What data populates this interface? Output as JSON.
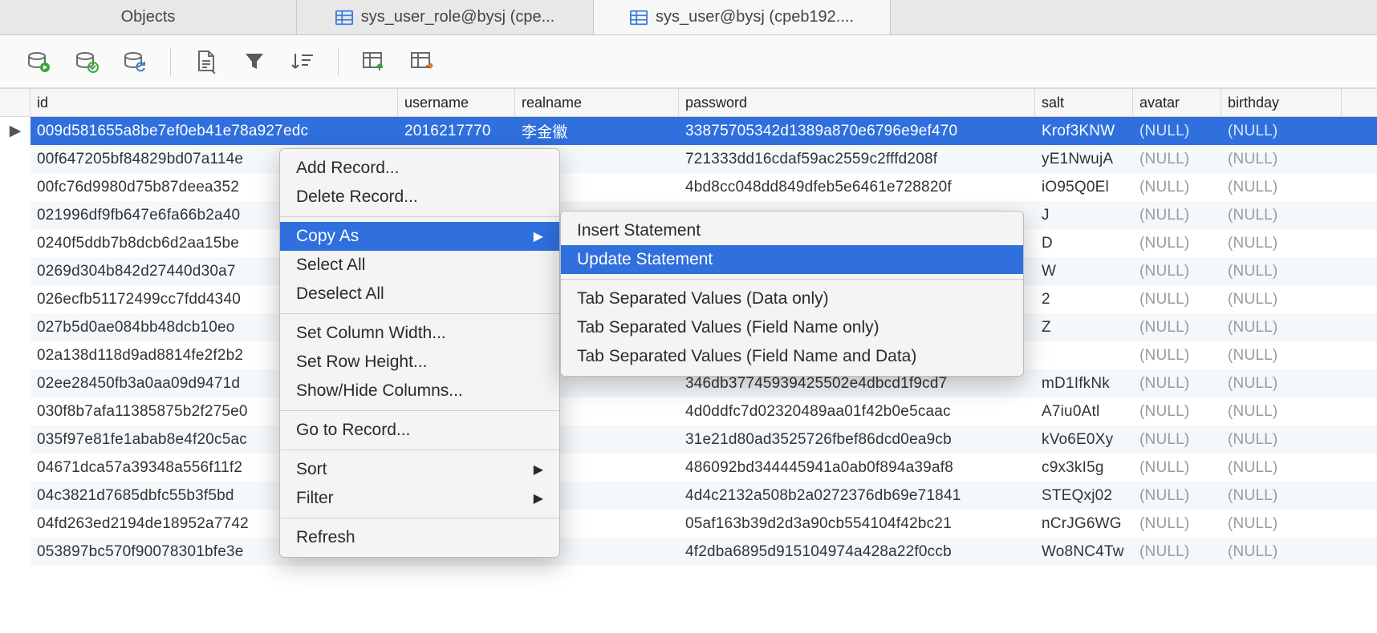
{
  "tabs": {
    "objects": "Objects",
    "t1": "sys_user_role@bysj (cpe...",
    "t2": "sys_user@bysj (cpeb192....",
    "active": "t2"
  },
  "columns": {
    "id": "id",
    "username": "username",
    "realname": "realname",
    "password": "password",
    "salt": "salt",
    "avatar": "avatar",
    "birthday": "birthday"
  },
  "null_text": "(NULL)",
  "rows": [
    {
      "id": "009d581655a8be7ef0eb41e78a927edc",
      "username": "2016217770",
      "realname": "李金徽",
      "password": "33875705342d1389a870e6796e9ef470",
      "salt": "Krof3KNW",
      "avatar": null,
      "birthday": null
    },
    {
      "id": "00f647205bf84829bd07a114e",
      "username": "",
      "realname": "",
      "password": "721333dd16cdaf59ac2559c2fffd208f",
      "salt": "yE1NwujA",
      "avatar": null,
      "birthday": null
    },
    {
      "id": "00fc76d9980d75b87deea352",
      "username": "",
      "realname": "",
      "password": "4bd8cc048dd849dfeb5e6461e728820f",
      "salt": "iO95Q0El",
      "avatar": null,
      "birthday": null
    },
    {
      "id": "021996df9fb647e6fa66b2a40",
      "username": "",
      "realname": "",
      "password": "",
      "salt": "J",
      "avatar": null,
      "birthday": null
    },
    {
      "id": "0240f5ddb7b8dcb6d2aa15be",
      "username": "",
      "realname": "",
      "password": "",
      "salt": "D",
      "avatar": null,
      "birthday": null
    },
    {
      "id": "0269d304b842d27440d30a7",
      "username": "",
      "realname": "",
      "password": "",
      "salt": "W",
      "avatar": null,
      "birthday": null
    },
    {
      "id": "026ecfb51172499cc7fdd4340",
      "username": "",
      "realname": "",
      "password": "",
      "salt": "2",
      "avatar": null,
      "birthday": null
    },
    {
      "id": "027b5d0ae084bb48dcb10eo",
      "username": "",
      "realname": "",
      "password": "",
      "salt": "Z",
      "avatar": null,
      "birthday": null
    },
    {
      "id": "02a138d118d9ad8814fe2f2b2",
      "username": "",
      "realname": "",
      "password": "",
      "salt": "",
      "avatar": null,
      "birthday": null
    },
    {
      "id": "02ee28450fb3a0aa09d9471d",
      "username": "",
      "realname": "",
      "password": "346db37745939425502e4dbcd1f9cd7",
      "salt": "mD1IfkNk",
      "avatar": null,
      "birthday": null
    },
    {
      "id": "030f8b7afa11385875b2f275e0",
      "username": "",
      "realname": "",
      "password": "4d0ddfc7d02320489aa01f42b0e5caac",
      "salt": "A7iu0Atl",
      "avatar": null,
      "birthday": null
    },
    {
      "id": "035f97e81fe1abab8e4f20c5ac",
      "username": "",
      "realname": "",
      "password": "31e21d80ad3525726fbef86dcd0ea9cb",
      "salt": "kVo6E0Xy",
      "avatar": null,
      "birthday": null
    },
    {
      "id": "04671dca57a39348a556f11f2",
      "username": "",
      "realname": "",
      "password": "486092bd344445941a0ab0f894a39af8",
      "salt": "c9x3kI5g",
      "avatar": null,
      "birthday": null
    },
    {
      "id": "04c3821d7685dbfc55b3f5bd",
      "username": "",
      "realname": "",
      "password": "4d4c2132a508b2a0272376db69e71841",
      "salt": "STEQxj02",
      "avatar": null,
      "birthday": null
    },
    {
      "id": "04fd263ed2194de18952a7742",
      "username": "",
      "realname": "",
      "password": "05af163b39d2d3a90cb554104f42bc21",
      "salt": "nCrJG6WG",
      "avatar": null,
      "birthday": null
    },
    {
      "id": "053897bc570f90078301bfe3e",
      "username": "",
      "realname": "",
      "password": "4f2dba6895d915104974a428a22f0ccb",
      "salt": "Wo8NC4Tw",
      "avatar": null,
      "birthday": null
    }
  ],
  "context_menu": {
    "add_record": "Add Record...",
    "delete_record": "Delete Record...",
    "copy_as": "Copy As",
    "select_all": "Select All",
    "deselect_all": "Deselect All",
    "set_col_width": "Set Column Width...",
    "set_row_height": "Set Row Height...",
    "show_hide_cols": "Show/Hide Columns...",
    "go_to_record": "Go to Record...",
    "sort": "Sort",
    "filter": "Filter",
    "refresh": "Refresh"
  },
  "copy_as_submenu": {
    "insert_stmt": "Insert Statement",
    "update_stmt": "Update Statement",
    "tsv_data": "Tab Separated Values (Data only)",
    "tsv_fieldname": "Tab Separated Values (Field Name only)",
    "tsv_both": "Tab Separated Values (Field Name and Data)"
  }
}
